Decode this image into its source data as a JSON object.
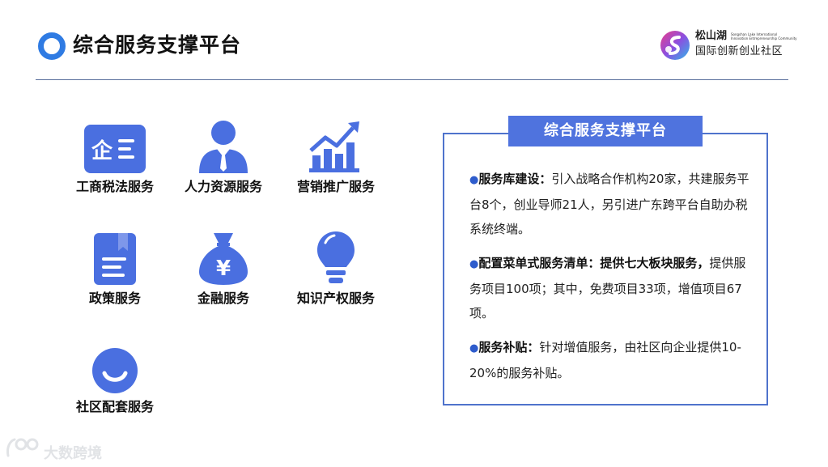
{
  "header": {
    "title": "综合服务支撑平台"
  },
  "logo": {
    "name": "松山湖",
    "en_line1": "Songshan Lake International",
    "en_line2": "Innovation Entrepreneurship Community",
    "sub": "国际创新创业社区"
  },
  "services": [
    {
      "label": "工商税法服务",
      "icon": "enterprise-icon",
      "icon_text": "企"
    },
    {
      "label": "人力资源服务",
      "icon": "person-icon"
    },
    {
      "label": "营销推广服务",
      "icon": "growth-chart-icon"
    },
    {
      "label": "政策服务",
      "icon": "document-icon"
    },
    {
      "label": "金融服务",
      "icon": "money-bag-icon",
      "icon_text": "¥"
    },
    {
      "label": "知识产权服务",
      "icon": "lightbulb-icon"
    },
    {
      "label": "社区配套服务",
      "icon": "smile-icon"
    }
  ],
  "info": {
    "title": "综合服务支撑平台",
    "bullet": "●",
    "items": [
      {
        "heading": "服务库建设：",
        "text": "引入战略合作机构20家，共建服务平台8个，创业导师21人，另引进广东跨平台自助办税系统终端。"
      },
      {
        "heading": "配置菜单式服务清单：提供七大板块服务，",
        "text": "提供服务项目100项；其中，免费项目33项，增值项目67项。"
      },
      {
        "heading": "服务补贴：",
        "text": "针对增值服务，由社区向企业提供10-20%的服务补贴。"
      }
    ]
  },
  "watermark": {
    "text": "大数跨境"
  },
  "colors": {
    "accent": "#4f73de",
    "icon_blue": "#4a6fe0",
    "title_ring": "#2f7be3",
    "rule": "#5a6f9c"
  }
}
